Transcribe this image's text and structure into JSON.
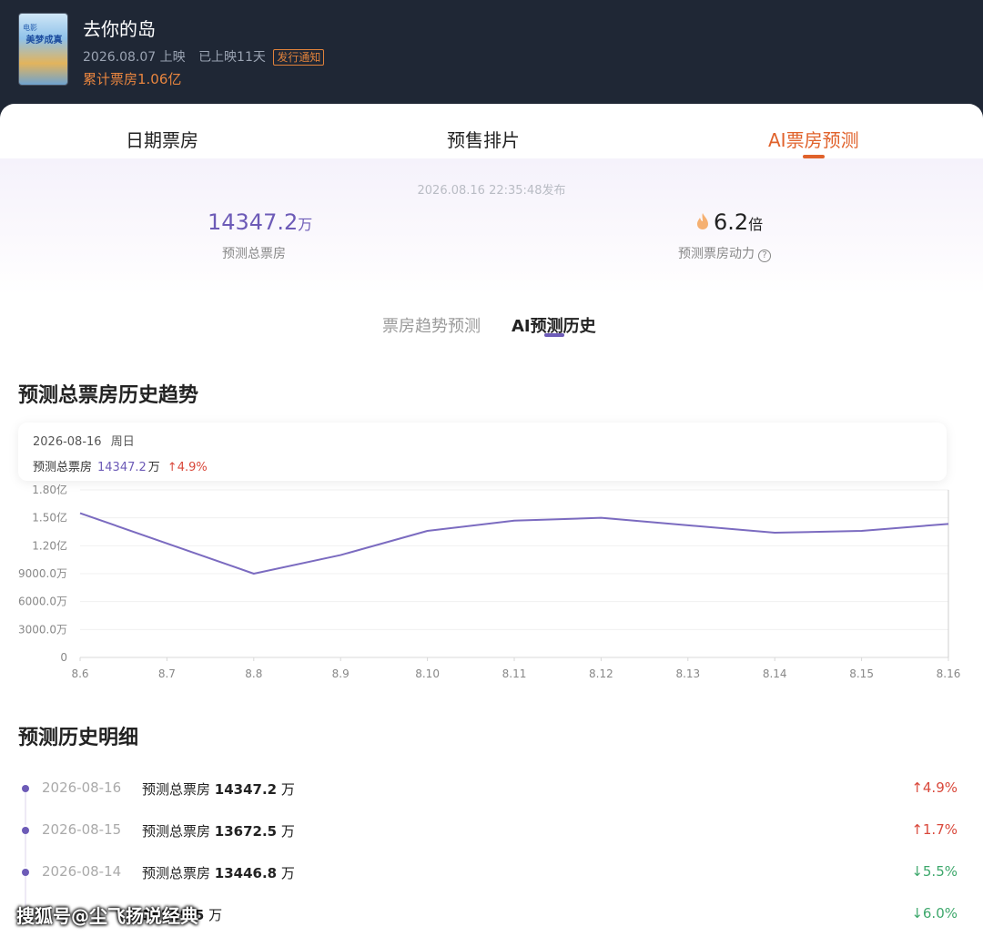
{
  "header": {
    "movie_title": "去你的岛",
    "release_date": "2026.08.07 上映",
    "days_showing": "已上映11天",
    "release_tag": "发行通知",
    "cumulative_box": "累计票房1.06亿",
    "poster_text_small": "电影",
    "poster_text_main": "美梦成真"
  },
  "tabs": [
    {
      "label": "日期票房",
      "active": false
    },
    {
      "label": "预售排片",
      "active": false
    },
    {
      "label": "AI票房预测",
      "active": true
    }
  ],
  "stats": {
    "publish_time": "2026.08.16 22:35:48发布",
    "predicted_total_value": "14347.2",
    "predicted_total_unit": "万",
    "predicted_total_label": "预测总票房",
    "power_value": "6.2",
    "power_unit": "倍",
    "power_label": "预测票房动力",
    "help_icon": "?"
  },
  "subtabs": [
    {
      "label": "票房趋势预测",
      "active": false
    },
    {
      "label": "AI预测历史",
      "active": true
    }
  ],
  "trend_section": {
    "title": "预测总票房历史趋势",
    "tooltip": {
      "date": "2026-08-16",
      "weekday": "周日",
      "label": "预测总票房",
      "value": "14347.2",
      "unit": "万",
      "change": "4.9%"
    }
  },
  "chart_data": {
    "type": "line",
    "title": "",
    "xlabel": "",
    "ylabel": "",
    "categories": [
      "8.6",
      "8.7",
      "8.8",
      "8.9",
      "8.10",
      "8.11",
      "8.12",
      "8.13",
      "8.14",
      "8.15",
      "8.16"
    ],
    "x_plotted": [
      "8.6",
      "8.8",
      "8.9",
      "8.10",
      "8.11",
      "8.12",
      "8.13",
      "8.14",
      "8.15",
      "8.16"
    ],
    "values": [
      15500,
      9000,
      11000,
      13600,
      14700,
      15000,
      14200,
      13400,
      13600,
      14347.2
    ],
    "ylim": [
      0,
      18000
    ],
    "ytick_values": [
      0,
      3000,
      6000,
      9000,
      12000,
      15000,
      18000
    ],
    "ytick_labels": [
      "0",
      "3000.0万",
      "6000.0万",
      "9000.0万",
      "1.20亿",
      "1.50亿",
      "1.80亿"
    ],
    "grid": true,
    "line_color": "#7b6bc0"
  },
  "history_section": {
    "title": "预测历史明细",
    "items": [
      {
        "date": "2026-08-16",
        "label": "预测总票房",
        "value": "14347.2",
        "unit": "万",
        "change": "4.9%",
        "direction": "up"
      },
      {
        "date": "2026-08-15",
        "label": "预测总票房",
        "value": "13672.5",
        "unit": "万",
        "change": "1.7%",
        "direction": "up"
      },
      {
        "date": "2026-08-14",
        "label": "预测总票房",
        "value": "13446.8",
        "unit": "万",
        "change": "5.5%",
        "direction": "down"
      },
      {
        "date": "",
        "label": "",
        "value": "14229.5",
        "unit": "万",
        "change": "6.0%",
        "direction": "down"
      }
    ]
  },
  "watermark": "搜狐号@尘飞扬说经典",
  "colors": {
    "header_bg": "#1f2735",
    "accent_orange": "#e0622b",
    "accent_purple": "#6d5bb7",
    "up_red": "#d9483b",
    "down_green": "#3ea86c"
  }
}
